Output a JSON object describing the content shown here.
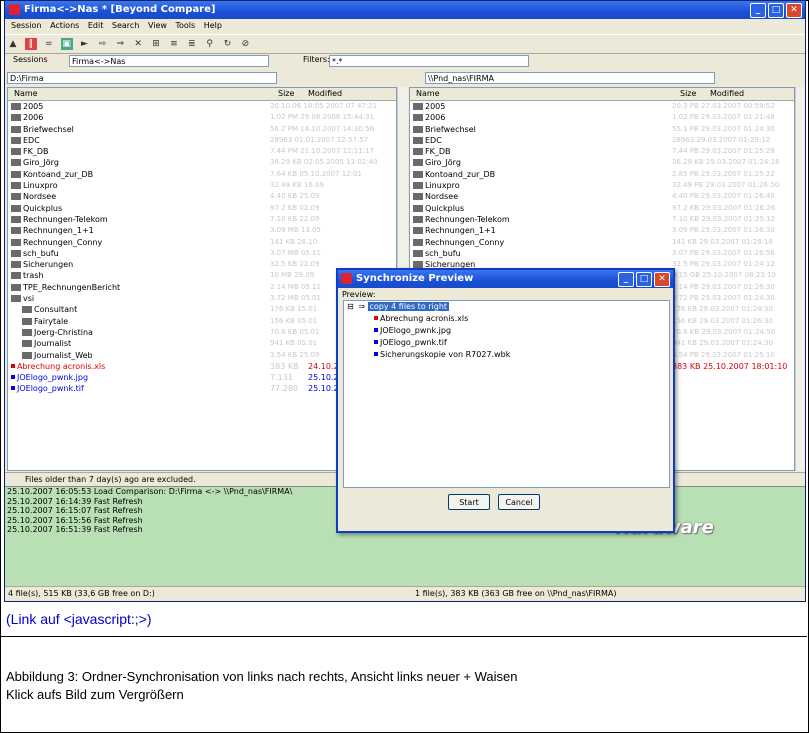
{
  "window": {
    "title": "Firma<->Nas * [Beyond Compare]",
    "logo_text": "Hardware"
  },
  "menu": [
    "Session",
    "Actions",
    "Edit",
    "Search",
    "View",
    "Tools",
    "Help"
  ],
  "session_bar": {
    "sessions_label": "Sessions",
    "session_name": "Firma<->Nas",
    "filters_label": "Filters:",
    "filters_value": "*.*"
  },
  "left_pane": {
    "path": "D:\\Firma",
    "columns": [
      "Name",
      "Size",
      "Modified"
    ],
    "rows": [
      {
        "name": "2005",
        "date": "20.10.06 18:05 2007 07 47:21"
      },
      {
        "name": "2006",
        "date": "1.02 PM 29.08.2006 15:44:31"
      },
      {
        "name": "Briefwechsel",
        "date": "56.2 PM 14.10.2007 14:30:56"
      },
      {
        "name": "EDC",
        "date": "28963 01.01.2007 12:57:57"
      },
      {
        "name": "FK_DB",
        "date": "7.44 PM 21.10.2007 12:11:17"
      },
      {
        "name": "Giro_Jörg",
        "date": "36.29 KB 02.05.2005 13:02:40"
      },
      {
        "name": "Kontoand_zur_DB",
        "date": "7.64 KB 05.10.2007 12:01"
      },
      {
        "name": "Linuxpro",
        "date": "32.49 KB 16.09"
      },
      {
        "name": "Nordsee",
        "date": "4.40 KB 25.09"
      },
      {
        "name": "Quickplus",
        "date": "97.2 KB 02.09"
      },
      {
        "name": "Rechnungen-Telekom",
        "date": "7.10 KB 22.09"
      },
      {
        "name": "Rechnungen_1+1",
        "date": "3.09 MB 13.05"
      },
      {
        "name": "Rechnungen_Conny",
        "date": "141 KB 26.10"
      },
      {
        "name": "sch_bufu",
        "date": "3.07 MB 05.11"
      },
      {
        "name": "Sicherungen",
        "date": "32.5 KB 22.09"
      },
      {
        "name": "trash",
        "date": "10 MB 29.09"
      },
      {
        "name": "TPE_RechnungenBericht",
        "date": "2.14 MB 05.11"
      },
      {
        "name": "vsi",
        "date": "3.72 MB 05.01"
      },
      {
        "name": "Consultant",
        "date": "176 KB 15.01"
      },
      {
        "name": "Fairytale",
        "date": "156 KB 05.01"
      },
      {
        "name": "Joerg-Christina",
        "date": "70.6 KB 05.01"
      },
      {
        "name": "Journalist",
        "date": "941 KB 05.01"
      },
      {
        "name": "Journalist_Web",
        "date": "3.54 KB 25.09"
      },
      {
        "name": "Abrechung acronis.xls",
        "size": "383 KB",
        "date": "24.10.2"
      },
      {
        "name": "JOElogo_pwnk.jpg",
        "size": "7.131",
        "date": "25.10.2"
      },
      {
        "name": "JOElogo_pwnk.tif",
        "size": "77.280",
        "date": "25.10.2"
      }
    ]
  },
  "right_pane": {
    "path": "\\\\Pnd_nas\\FIRMA",
    "columns": [
      "Name",
      "Size",
      "Modified"
    ],
    "rows": [
      {
        "name": "2005",
        "date": "20.3 PB 27.03.2007 00:59:52"
      },
      {
        "name": "2006",
        "date": "1.02 PB 29.03.2007 01:21:48"
      },
      {
        "name": "Briefwechsel",
        "date": "55.1 PB 29.03.2007 01:24:30"
      },
      {
        "name": "EDC",
        "date": "28963 29.03.2007 01:29:12"
      },
      {
        "name": "FK_DB",
        "date": "7.44 PB 29.03.2007 01:25:28"
      },
      {
        "name": "Giro_Jörg",
        "date": "36.29 KB 29.03.2007 01:24:16"
      },
      {
        "name": "Kontoand_zur_DB",
        "date": "2.85 PB 29.03.2007 01:25:22"
      },
      {
        "name": "Linuxpro",
        "date": "32.49 PB 29.03.2007 01:26:50"
      },
      {
        "name": "Nordsee",
        "date": "4.40 PB 29.03.2007 01:26:40"
      },
      {
        "name": "Quickplus",
        "date": "97.2 KB 29.03.2007 01:26:26"
      },
      {
        "name": "Rechnungen-Telekom",
        "date": "7.10 KB 29.03.2007 01:25:12"
      },
      {
        "name": "Rechnungen_1+1",
        "date": "3.09 PB 29.03.2007 01:26:30"
      },
      {
        "name": "Rechnungen_Conny",
        "date": "141 KB 29.03.2007 01:26:18"
      },
      {
        "name": "sch_bufu",
        "date": "3.07 PB 29.03.2007 01:26:56"
      },
      {
        "name": "Sicherungen",
        "date": "32.5 PB 29.03.2007 01:24:12"
      },
      {
        "name": "trash",
        "date": "0.15 GB 25.10.2007 08:23:10"
      },
      {
        "name": "TPE_RechnungenBericht",
        "date": "2.14 PB 29.03.2007 01:26:30"
      },
      {
        "name": "vsi",
        "date": "3.72 PB 29.03.2007 01:24:30"
      },
      {
        "name": "Consultant",
        "date": "176 KB 29.03.2007 01:24:30"
      },
      {
        "name": "Fairytale",
        "date": "156 KB 29.03.2007 01:26:30"
      },
      {
        "name": "Joerg-Christina",
        "date": "70.6 KB 29.03.2007 01:24:50"
      },
      {
        "name": "Journalist",
        "date": "941 KB 29.03.2007 01:24:30"
      },
      {
        "name": "Journalist_Web",
        "date": "3.54 PB 29.03.2007 01:25:10"
      },
      {
        "name": "",
        "date": "383 KB 25.10.2007 18:01:10"
      }
    ]
  },
  "excluded_text": "Files older than 7 day(s) ago are excluded.",
  "log": [
    "25.10.2007 16:05:53  Load Comparison: D:\\Firma <-> \\\\Pnd_nas\\FIRMA\\",
    "25.10.2007 16:14:39  Fast Refresh",
    "25.10.2007 16:15:07  Fast Refresh",
    "25.10.2007 16:15:56  Fast Refresh",
    "25.10.2007 16:51:39  Fast Refresh"
  ],
  "status": {
    "left": "4 file(s), 515 KB  (33,6 GB free on D:)",
    "right": "1 file(s), 383 KB  (363 GB free on \\\\Pnd_nas\\FIRMA)"
  },
  "dialog": {
    "title": "Synchronize Preview",
    "preview_label": "Preview:",
    "root": "copy 4 files to right",
    "items": [
      {
        "name": "Abrechung acronis.xls",
        "color": "#e00000"
      },
      {
        "name": "JOElogo_pwnk.jpg",
        "color": "#0000e0"
      },
      {
        "name": "JOElogo_pwnk.tif",
        "color": "#0000e0"
      },
      {
        "name": "Sicherungskopie von R7027.wbk",
        "color": "#0000e0"
      }
    ],
    "start_label": "Start",
    "cancel_label": "Cancel"
  },
  "caption": {
    "link": "(Link auf <javascript:;>)",
    "line1": "Abbildung 3: Ordner-Synchronisation von links nach rechts, Ansicht links neuer + Waisen",
    "line2": "Klick aufs Bild zum Vergrößern"
  }
}
